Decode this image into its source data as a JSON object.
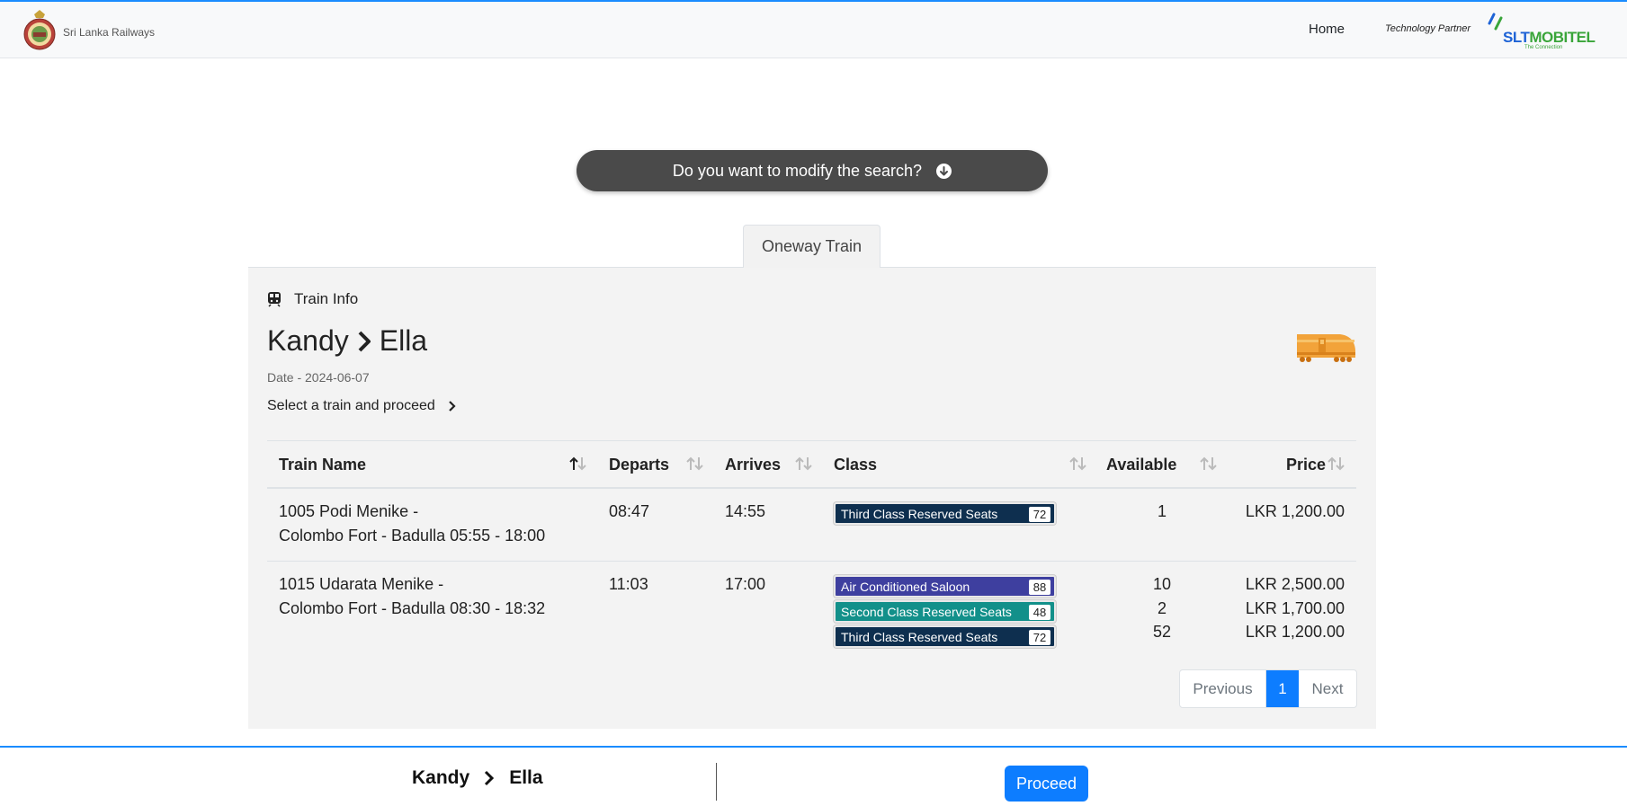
{
  "header": {
    "brand_name": "Sri Lanka Railways",
    "nav_home": "Home",
    "tech_partner": "Technology Partner",
    "partner_logo_slt": "SLT",
    "partner_logo_mobitel": "MOBITEL",
    "partner_tagline": "The Connection"
  },
  "search": {
    "modify_label": "Do you want to modify the search?"
  },
  "tabs": [
    {
      "label": "Oneway Train",
      "active": true
    }
  ],
  "train_info": {
    "section_label": "Train Info",
    "from": "Kandy",
    "to": "Ella",
    "date_text": "Date - 2024-06-07",
    "hint": "Select a train and proceed"
  },
  "table": {
    "columns": [
      "Train Name",
      "Departs",
      "Arrives",
      "Class",
      "Available",
      "Price"
    ],
    "rows": [
      {
        "train_line1": "1005 Podi Menike -",
        "train_line2": "Colombo Fort - Badulla 05:55 - 18:00",
        "departs": "08:47",
        "arrives": "14:55",
        "classes": [
          {
            "name": "Third Class Reserved Seats",
            "count": "72",
            "available": "1",
            "price": "LKR 1,200.00",
            "color": "#0e2f4f"
          }
        ]
      },
      {
        "train_line1": "1015 Udarata Menike -",
        "train_line2": "Colombo Fort - Badulla 08:30 - 18:32",
        "departs": "11:03",
        "arrives": "17:00",
        "classes": [
          {
            "name": "Air Conditioned Saloon",
            "count": "88",
            "available": "10",
            "price": "LKR 2,500.00",
            "color": "#3e3f9f"
          },
          {
            "name": "Second Class Reserved Seats",
            "count": "48",
            "available": "2",
            "price": "LKR 1,700.00",
            "color": "#12908a"
          },
          {
            "name": "Third Class Reserved Seats",
            "count": "72",
            "available": "52",
            "price": "LKR 1,200.00",
            "color": "#0e2f4f"
          }
        ]
      }
    ]
  },
  "pagination": {
    "previous": "Previous",
    "current": "1",
    "next": "Next"
  },
  "footer": {
    "from": "Kandy",
    "to": "Ella",
    "proceed_label": "Proceed"
  },
  "colors": {
    "accent": "#0d7dff",
    "header_border": "#1a8cff",
    "modify_bg": "#4a4a4a"
  }
}
